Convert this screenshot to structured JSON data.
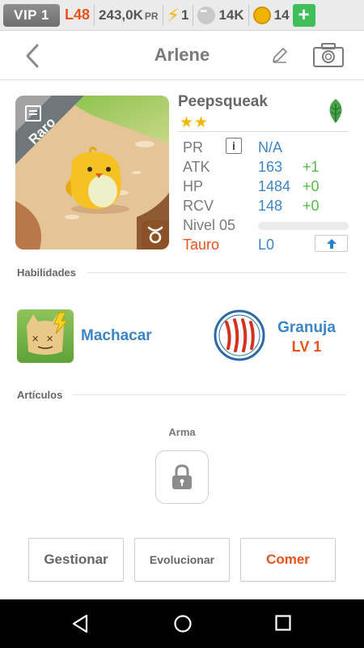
{
  "statusbar": {
    "vip": "VIP 1",
    "level": "L48",
    "pr_value": "243,0K",
    "pr_unit": "PR",
    "energy": "1",
    "paws": "14K",
    "coins": "14",
    "plus": "+"
  },
  "header": {
    "title": "Arlene"
  },
  "pet": {
    "rarity": "Raro",
    "species": "Peepsqueak",
    "stars": "★★",
    "stats": {
      "pr_label": "PR",
      "pr_info": "i",
      "pr_value": "N/A",
      "atk_label": "ATK",
      "atk_value": "163",
      "atk_bonus": "+1",
      "hp_label": "HP",
      "hp_value": "1484",
      "hp_bonus": "+0",
      "rcv_label": "RCV",
      "rcv_value": "148",
      "rcv_bonus": "+0",
      "level_label": "Nivel 05",
      "level_progress": 0,
      "zodiac_label": "Tauro",
      "zodiac_level": "L0"
    }
  },
  "sections": {
    "skills": "Habilidades",
    "items": "Artículos",
    "weapon": "Arma"
  },
  "skill": {
    "name": "Machacar"
  },
  "ability": {
    "name": "Granuja",
    "level": "LV 1"
  },
  "buttons": {
    "manage": "Gestionar",
    "evolve": "Evolucionar",
    "eat": "Comer"
  },
  "colors": {
    "accent_blue": "#3d84c6",
    "accent_orange": "#e8531b",
    "bonus_green": "#58b84a",
    "plus_green": "#3ebf5a"
  }
}
